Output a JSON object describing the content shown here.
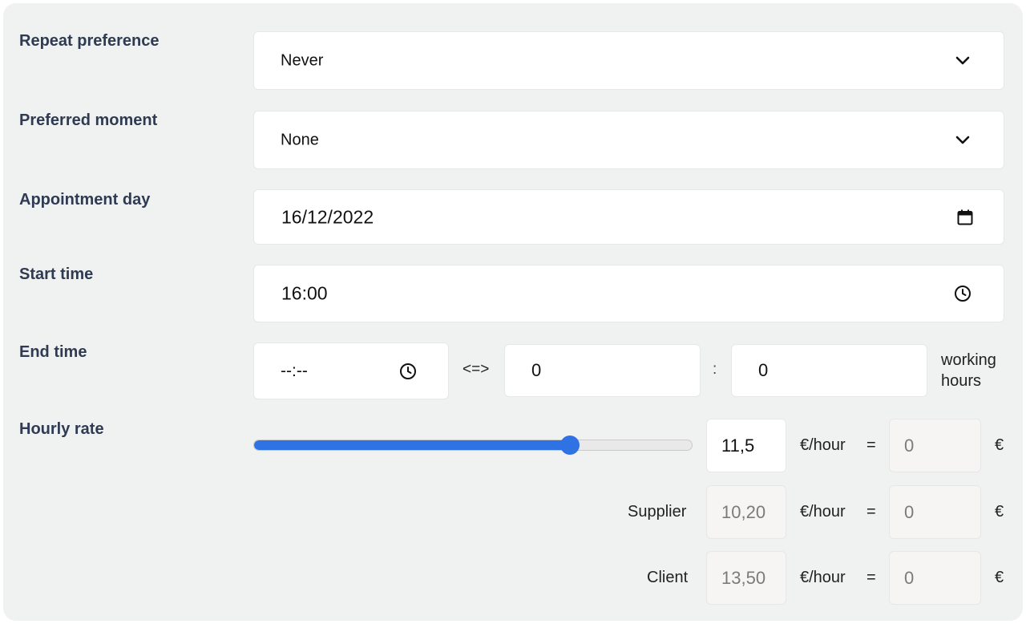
{
  "form": {
    "repeat": {
      "label": "Repeat preference",
      "value": "Never"
    },
    "moment": {
      "label": "Preferred moment",
      "value": "None"
    },
    "day": {
      "label": "Appointment day",
      "value": "16/12/2022"
    },
    "start": {
      "label": "Start time",
      "value": "16:00"
    },
    "end": {
      "label": "End time",
      "value": "--:--",
      "equiv": "<=>",
      "hours": "0",
      "separator": ":",
      "minutes": "0",
      "unit_line1": "working",
      "unit_line2": "hours"
    },
    "rate": {
      "label": "Hourly rate",
      "value": "11,5",
      "slider_fraction": 0.72,
      "unit": "€/hour",
      "eq": "=",
      "total": "0",
      "currency": "€"
    },
    "supplier": {
      "label": "Supplier",
      "value": "10,20",
      "unit": "€/hour",
      "eq": "=",
      "total": "0",
      "currency": "€"
    },
    "client": {
      "label": "Client",
      "value": "13,50",
      "unit": "€/hour",
      "eq": "=",
      "total": "0",
      "currency": "€"
    }
  },
  "colors": {
    "accent": "#2f72e4",
    "panel": "#f0f1f1",
    "label": "#2f3b52"
  },
  "icons": {
    "select": "chevron-down-icon",
    "date": "calendar-icon",
    "time": "clock-icon"
  }
}
